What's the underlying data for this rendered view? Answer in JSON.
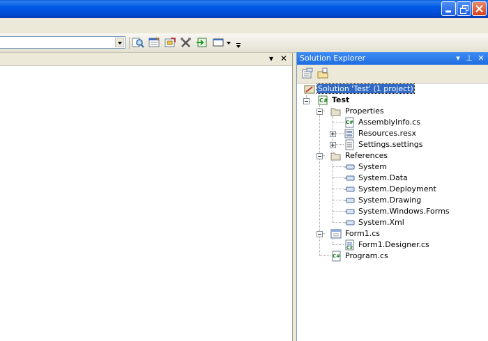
{
  "solution_explorer": {
    "title": "Solution Explorer",
    "tree": {
      "solution": "Solution 'Test' (1 project)",
      "project": "Test",
      "properties": {
        "label": "Properties",
        "children": [
          "AssemblyInfo.cs",
          "Resources.resx",
          "Settings.settings"
        ]
      },
      "references": {
        "label": "References",
        "children": [
          "System",
          "System.Data",
          "System.Deployment",
          "System.Drawing",
          "System.Windows.Forms",
          "System.Xml"
        ]
      },
      "form1": "Form1.cs",
      "form1_designer": "Form1.Designer.cs",
      "program": "Program.cs"
    }
  },
  "doc_pane": {
    "pin_glyph": "▾",
    "close_glyph": "✕"
  },
  "colors": {
    "titlebar": "#0058e6",
    "panel_header": "#2a76e6",
    "selection": "#316ac5"
  }
}
